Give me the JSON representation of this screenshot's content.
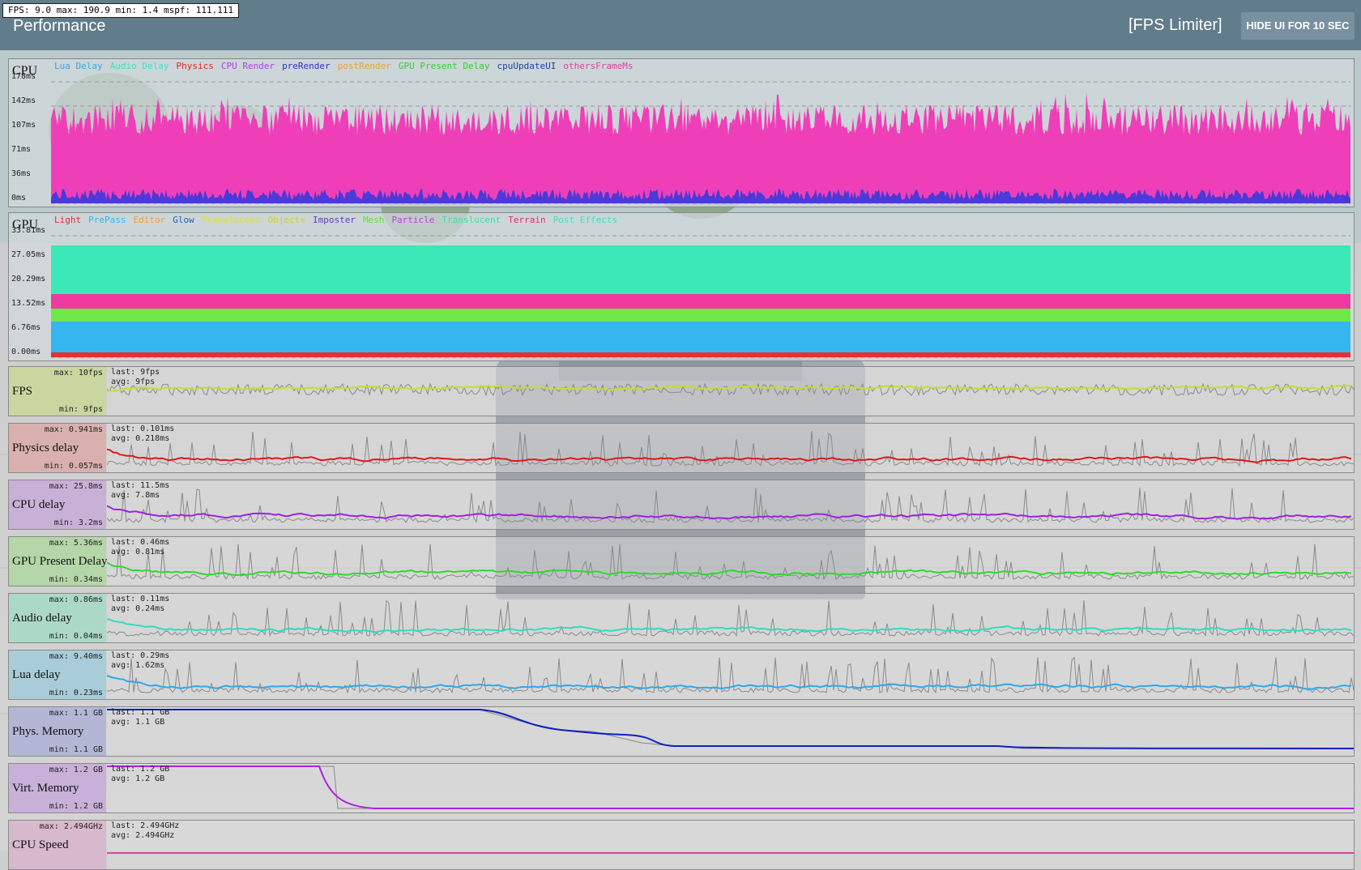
{
  "fps_readout": {
    "text": "FPS:   9.0  max: 190.9  min:  1.4  mspf: 111.111"
  },
  "header": {
    "title": "Performance",
    "fps_limiter": "[FPS Limiter]",
    "hide_button": "HIDE UI FOR 10 SEC",
    "bg_color": "#617c8a"
  },
  "cpu_panel": {
    "label": "CPU",
    "legend": [
      {
        "label": "Lua Delay",
        "color": "#3aa6e8"
      },
      {
        "label": "Audio Delay",
        "color": "#3fe0c0"
      },
      {
        "label": "Physics",
        "color": "#e02828"
      },
      {
        "label": "CPU Render",
        "color": "#b040e0"
      },
      {
        "label": "preRender",
        "color": "#3030c0"
      },
      {
        "label": "postRender",
        "color": "#f0a030"
      },
      {
        "label": "GPU Present Delay",
        "color": "#30d030"
      },
      {
        "label": "cpuUpdateUI",
        "color": "#2040a0"
      },
      {
        "label": "othersFrameMs",
        "color": "#e040a0"
      }
    ],
    "ticks": [
      "178ms",
      "142ms",
      "107ms",
      "71ms",
      "36ms",
      "0ms"
    ]
  },
  "gpu_panel": {
    "label": "GPU",
    "legend": [
      {
        "label": "Light",
        "color": "#e03030"
      },
      {
        "label": "PrePass",
        "color": "#30b8f0"
      },
      {
        "label": "Editor",
        "color": "#f0a030"
      },
      {
        "label": "Glow",
        "color": "#2060c0"
      },
      {
        "label": "Translucent",
        "color": "#e0e030"
      },
      {
        "label": "Objects",
        "color": "#d0d030"
      },
      {
        "label": "Imposter",
        "color": "#6040c0"
      },
      {
        "label": "Mesh",
        "color": "#60e040"
      },
      {
        "label": "Particle",
        "color": "#c040e0"
      },
      {
        "label": "Translucent",
        "color": "#40e0a0"
      },
      {
        "label": "Terrain",
        "color": "#e03070"
      },
      {
        "label": "Post Effects",
        "color": "#40e0c0"
      }
    ],
    "ticks": [
      "33.81ms",
      "27.05ms",
      "20.29ms",
      "13.52ms",
      "6.76ms",
      "0.00ms"
    ]
  },
  "metrics": [
    {
      "name": "FPS",
      "max": "max: 10fps",
      "min": "min: 9fps",
      "last": "last: 9fps",
      "avg": "avg: 9fps",
      "color": "#c8dc30",
      "bg": "#c9d6a0"
    },
    {
      "name": "Physics delay",
      "max": "max: 0.941ms",
      "min": "min: 0.057ms",
      "last": "last: 0.101ms",
      "avg": "avg: 0.218ms",
      "color": "#e01818",
      "bg": "#d9b0ae"
    },
    {
      "name": "CPU delay",
      "max": "max: 25.8ms",
      "min": "min: 3.2ms",
      "last": "last: 11.5ms",
      "avg": "avg: 7.8ms",
      "color": "#a020e0",
      "bg": "#c8b0d6"
    },
    {
      "name": "GPU Present Delay",
      "max": "max: 5.36ms",
      "min": "min: 0.34ms",
      "last": "last: 0.46ms",
      "avg": "avg: 0.81ms",
      "color": "#30d830",
      "bg": "#b4d6a8"
    },
    {
      "name": "Audio delay",
      "max": "max: 0.86ms",
      "min": "min: 0.04ms",
      "last": "last: 0.11ms",
      "avg": "avg: 0.24ms",
      "color": "#30dcc0",
      "bg": "#acd8c8"
    },
    {
      "name": "Lua delay",
      "max": "max: 9.40ms",
      "min": "min: 0.23ms",
      "last": "last: 0.29ms",
      "avg": "avg: 1.62ms",
      "color": "#30a8e8",
      "bg": "#a8ccd8"
    },
    {
      "name": "Phys. Memory",
      "max": "max: 1.1 GB",
      "min": "min: 1.1 GB",
      "last": "last: 1.1 GB",
      "avg": "avg: 1.1 GB",
      "color": "#1020c0",
      "bg": "#b4b6d6"
    },
    {
      "name": "Virt. Memory",
      "max": "max: 1.2 GB",
      "min": "min: 1.2 GB",
      "last": "last: 1.2 GB",
      "avg": "avg: 1.2 GB",
      "color": "#b020e0",
      "bg": "#c8b0d8"
    },
    {
      "name": "CPU Speed",
      "max": "max: 2.494GHz",
      "min": "",
      "last": "last: 2.494GHz",
      "avg": "avg: 2.494GHz",
      "color": "#e040a0",
      "bg": "#d8b8cc"
    }
  ]
}
